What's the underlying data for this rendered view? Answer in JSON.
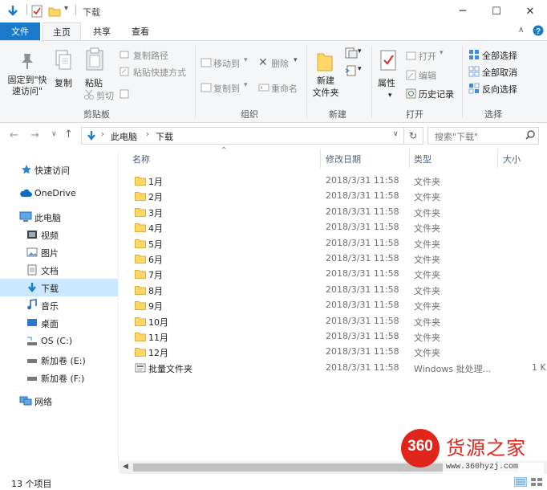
{
  "window": {
    "title": "下载",
    "minimize": "─",
    "maximize": "☐",
    "close": "✕"
  },
  "tabs": {
    "file": "文件",
    "home": "主页",
    "share": "共享",
    "view": "查看"
  },
  "ribbon": {
    "pin_quick_access": "固定到\"快速访问\"",
    "copy": "复制",
    "paste": "粘贴",
    "copy_path": "复制路径",
    "paste_shortcut": "粘贴快捷方式",
    "cut": "剪切",
    "group_clipboard": "剪贴板",
    "move_to": "移动到",
    "copy_to": "复制到",
    "delete": "删除",
    "rename": "重命名",
    "group_organize": "组织",
    "new_folder": "新建\n文件夹",
    "group_new": "新建",
    "properties": "属性",
    "open": "打开",
    "edit": "编辑",
    "history": "历史记录",
    "group_open": "打开",
    "select_all": "全部选择",
    "select_none": "全部取消",
    "invert_selection": "反向选择",
    "group_select": "选择"
  },
  "address": {
    "crumbs": [
      "此电脑",
      "下载"
    ],
    "search_placeholder": "搜索\"下载\""
  },
  "nav": [
    {
      "label": "快速访问",
      "icon": "star-icon"
    },
    {
      "label": "OneDrive",
      "icon": "cloud-icon"
    },
    {
      "label": "此电脑",
      "icon": "computer-icon"
    },
    {
      "label": "视频",
      "icon": "video-icon"
    },
    {
      "label": "图片",
      "icon": "picture-icon"
    },
    {
      "label": "文档",
      "icon": "document-icon"
    },
    {
      "label": "下载",
      "icon": "download-icon"
    },
    {
      "label": "音乐",
      "icon": "music-icon"
    },
    {
      "label": "桌面",
      "icon": "desktop-icon"
    },
    {
      "label": "OS (C:)",
      "icon": "drive-icon"
    },
    {
      "label": "新加卷 (E:)",
      "icon": "drive-icon"
    },
    {
      "label": "新加卷 (F:)",
      "icon": "drive-icon"
    },
    {
      "label": "网络",
      "icon": "network-icon"
    }
  ],
  "columns": {
    "name": "名称",
    "modified": "修改日期",
    "type": "类型",
    "size": "大小"
  },
  "files": [
    {
      "name": "1月",
      "modified": "2018/3/31 11:58",
      "type": "文件夹",
      "size": ""
    },
    {
      "name": "2月",
      "modified": "2018/3/31 11:58",
      "type": "文件夹",
      "size": ""
    },
    {
      "name": "3月",
      "modified": "2018/3/31 11:58",
      "type": "文件夹",
      "size": ""
    },
    {
      "name": "4月",
      "modified": "2018/3/31 11:58",
      "type": "文件夹",
      "size": ""
    },
    {
      "name": "5月",
      "modified": "2018/3/31 11:58",
      "type": "文件夹",
      "size": ""
    },
    {
      "name": "6月",
      "modified": "2018/3/31 11:58",
      "type": "文件夹",
      "size": ""
    },
    {
      "name": "7月",
      "modified": "2018/3/31 11:58",
      "type": "文件夹",
      "size": ""
    },
    {
      "name": "8月",
      "modified": "2018/3/31 11:58",
      "type": "文件夹",
      "size": ""
    },
    {
      "name": "9月",
      "modified": "2018/3/31 11:58",
      "type": "文件夹",
      "size": ""
    },
    {
      "name": "10月",
      "modified": "2018/3/31 11:58",
      "type": "文件夹",
      "size": ""
    },
    {
      "name": "11月",
      "modified": "2018/3/31 11:58",
      "type": "文件夹",
      "size": ""
    },
    {
      "name": "12月",
      "modified": "2018/3/31 11:58",
      "type": "文件夹",
      "size": ""
    },
    {
      "name": "批量文件夹",
      "modified": "2018/3/31 11:58",
      "type": "Windows 批处理...",
      "size": "1 K"
    }
  ],
  "status": {
    "count": "13 个项目"
  },
  "watermark": {
    "badge": "360",
    "brand": "货源之家",
    "url": "www.360hyzj.com"
  },
  "colors": {
    "accent": "#1979ca",
    "selection": "#cce8ff",
    "folder": "#ffd766",
    "watermark_red": "#e1251b"
  }
}
